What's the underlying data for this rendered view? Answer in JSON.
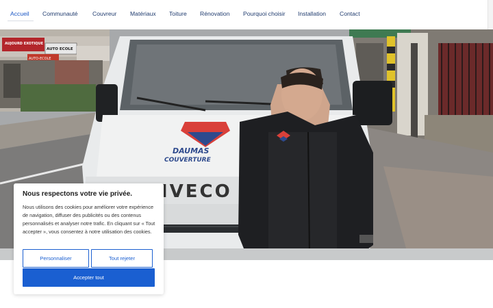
{
  "nav": {
    "items": [
      {
        "label": "Accueil",
        "active": true
      },
      {
        "label": "Communauté"
      },
      {
        "label": "Couvreur"
      },
      {
        "label": "Matériaux"
      },
      {
        "label": "Toiture"
      },
      {
        "label": "Rénovation"
      },
      {
        "label": "Pourquoi choisir"
      },
      {
        "label": "Installation"
      },
      {
        "label": "Contact"
      }
    ]
  },
  "hero": {
    "shop_sign_1": "AUJOURD EXOTIQUE",
    "shop_sign_2": "AUTO ECOLE",
    "shop_sign_3": "AUTO-ECOLE",
    "van_logo_line1": "DAUMAS",
    "van_logo_line2": "COUVERTURE",
    "van_brand": "IVECO"
  },
  "cookie": {
    "title": "Nous respectons votre vie privée.",
    "text": "Nous utilisons des cookies pour améliorer votre expérience de navigation, diffuser des publicités ou des contenus personnalisés et analyser notre trafic. En cliquant sur « Tout accepter », vous consentez à notre utilisation des cookies.",
    "customize_label": "Personnaliser",
    "reject_label": "Tout rejeter",
    "accept_label": "Accepter tout"
  },
  "colors": {
    "accent": "#1a5fd1",
    "nav_text": "#1f3b6e",
    "logo_red": "#d9403a",
    "logo_blue": "#2e4a8d"
  }
}
